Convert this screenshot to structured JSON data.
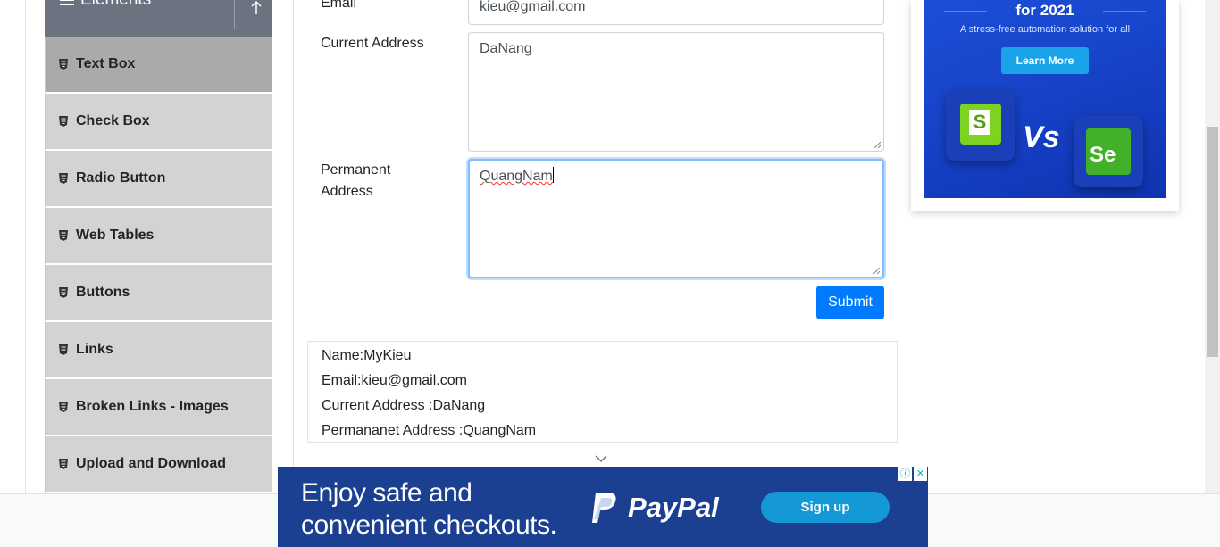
{
  "sidebar": {
    "group_title": "Elements",
    "items": [
      {
        "label": "Text Box",
        "active": true
      },
      {
        "label": "Check Box",
        "active": false
      },
      {
        "label": "Radio Button",
        "active": false
      },
      {
        "label": "Web Tables",
        "active": false
      },
      {
        "label": "Buttons",
        "active": false
      },
      {
        "label": "Links",
        "active": false
      },
      {
        "label": "Broken Links - Images",
        "active": false
      },
      {
        "label": "Upload and Download",
        "active": false
      }
    ]
  },
  "form": {
    "email_label": "Email",
    "email_value": "kieu@gmail.com",
    "current_address_label": "Current Address",
    "current_address_value": "DaNang",
    "permanent_address_label_line1": "Permanent",
    "permanent_address_label_line2": "Address",
    "permanent_address_value": "QuangNam",
    "submit_label": "Submit"
  },
  "output": {
    "name": "Name:MyKieu",
    "email": "Email:kieu@gmail.com",
    "current_address": "Current Address :DaNang",
    "permanent_address": "Permananet Address :QuangNam"
  },
  "side_ad": {
    "headline": "for 2021",
    "tagline": "A stress-free automation solution for all",
    "cta": "Learn More",
    "vs_text": "Vs",
    "left_logo": "S",
    "right_logo": "Se"
  },
  "bottom_ad": {
    "line1": "Enjoy safe and",
    "line2": "convenient checkouts.",
    "brand": "PayPal",
    "cta": "Sign up",
    "adchoices_icon": "info-icon",
    "close_icon": "close-icon"
  },
  "colors": {
    "primary": "#007bff",
    "sidebar_item": "#d3d3d3",
    "sidebar_active": "#aaaaaa",
    "group_header": "#6b7280",
    "paypal_bg": "#1b3f91"
  }
}
